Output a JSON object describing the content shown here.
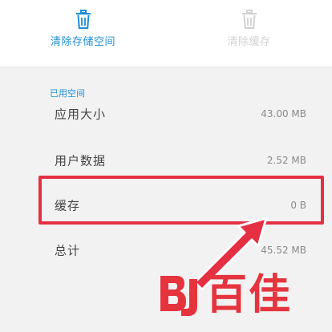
{
  "actions": {
    "clear_storage": {
      "label": "清除存储空间",
      "icon": "trash-icon",
      "enabled": true
    },
    "clear_cache": {
      "label": "清除缓存",
      "icon": "trash-icon",
      "enabled": false
    }
  },
  "storage": {
    "section_title": "已用空间",
    "rows": [
      {
        "key": "应用大小",
        "value": "43.00 MB"
      },
      {
        "key": "用户数据",
        "value": "2.52 MB"
      },
      {
        "key": "缓存",
        "value": "0 B"
      },
      {
        "key": "总计",
        "value": "45.52 MB"
      }
    ]
  },
  "annotation": {
    "highlight_color": "#e53044",
    "highlighted_row": "缓存"
  },
  "watermark": {
    "text": "百佳",
    "logo": "bj-logo",
    "color": "#e5343e"
  },
  "colors": {
    "accent": "#1d8ed6",
    "disabled": "#d2d2d2",
    "section_bg": "#f2f2f2"
  }
}
